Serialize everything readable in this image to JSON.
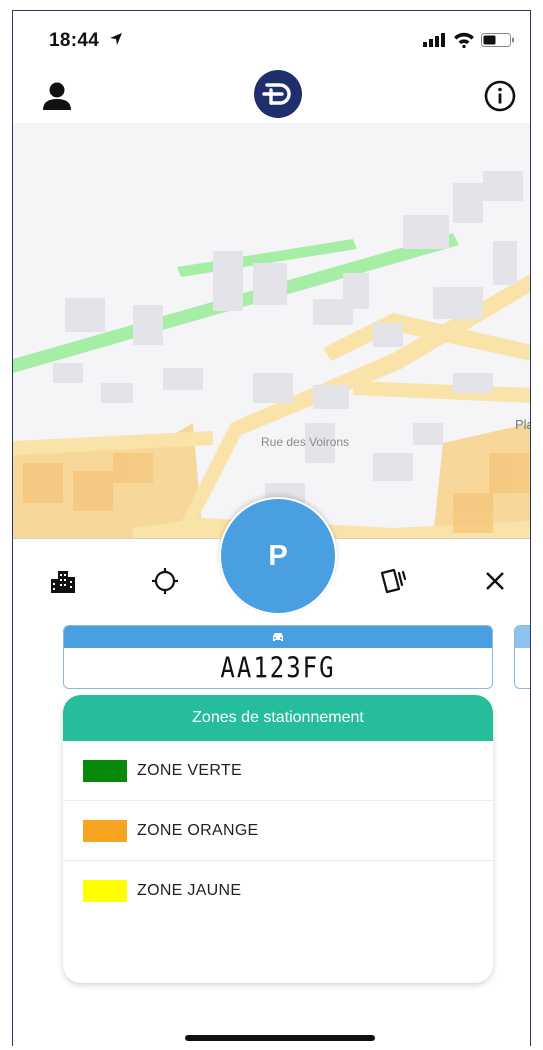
{
  "status_bar": {
    "time": "18:44"
  },
  "map": {
    "street_label": "Rue des Voirons",
    "edge_label": "Plac"
  },
  "parking_button": {
    "label": "P"
  },
  "plate": {
    "number": "AA123FG"
  },
  "zones": {
    "title": "Zones de stationnement",
    "items": [
      {
        "label": "ZONE VERTE",
        "color": "#078a0a"
      },
      {
        "label": "ZONE ORANGE",
        "color": "#f7a421"
      },
      {
        "label": "ZONE JAUNE",
        "color": "#ffff00"
      }
    ]
  },
  "icons": {
    "header": [
      "user-icon",
      "logo-icon",
      "info-icon"
    ],
    "toolbar": [
      "city-icon",
      "locate-icon",
      "ticket-icon",
      "close-icon"
    ]
  },
  "colors": {
    "accent_blue": "#4a9fe0",
    "teal": "#26bd9c"
  }
}
